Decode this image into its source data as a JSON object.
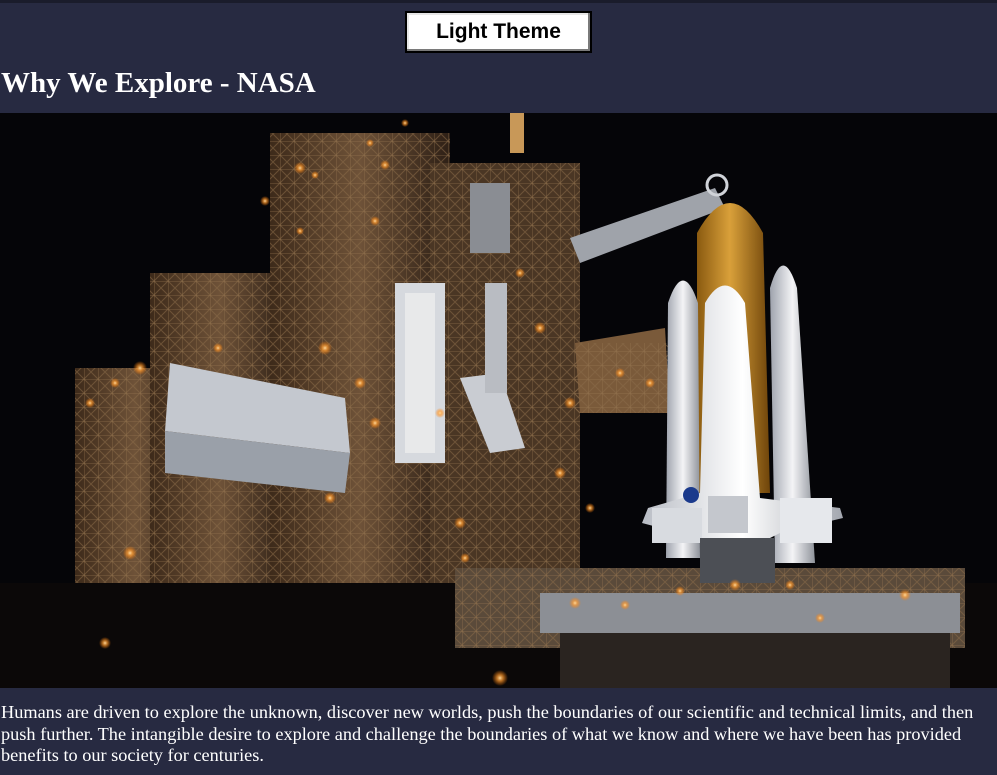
{
  "theme_toggle": {
    "label": "Light Theme"
  },
  "page": {
    "title": "Why We Explore - NASA"
  },
  "hero": {
    "alt": "Space shuttle on the launch pad at night"
  },
  "intro": {
    "text": "Humans are driven to explore the unknown, discover new worlds, push the boundaries of our scientific and technical limits, and then push further. The intangible desire to explore and challenge the boundaries of what we know and where we have been has provided benefits to our society for centuries."
  },
  "colors": {
    "background": "#272a41",
    "text": "#ffffff",
    "button_bg": "#ffffff",
    "button_text": "#000000"
  }
}
